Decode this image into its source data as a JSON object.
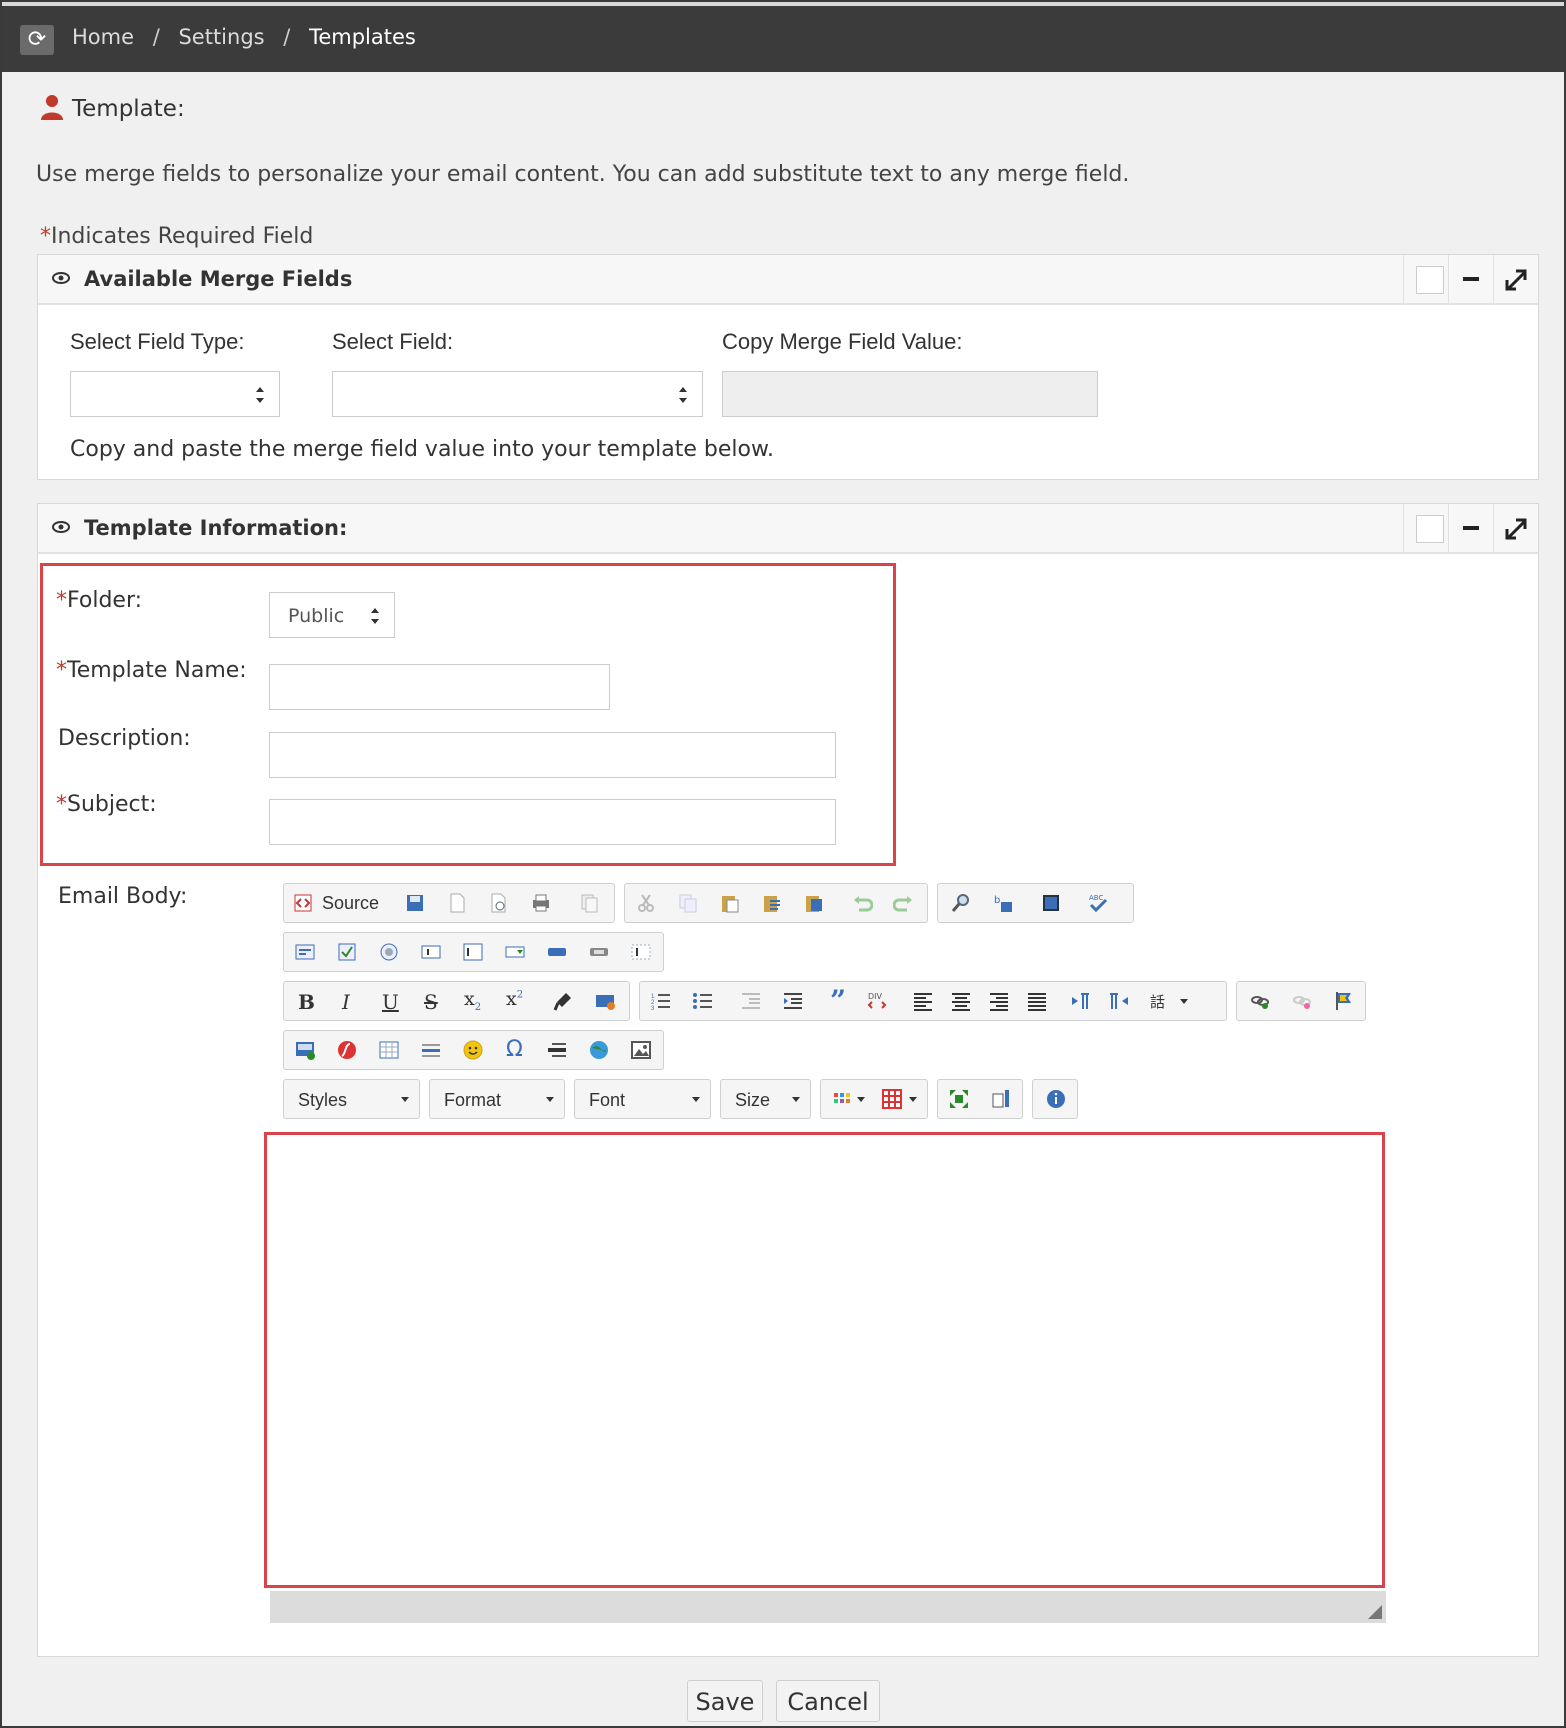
{
  "breadcrumb": {
    "home": "Home",
    "settings": "Settings",
    "current": "Templates",
    "separator": "/"
  },
  "page": {
    "title": "Template:",
    "intro": "Use merge fields to personalize your email content. You can add substitute text to any merge field.",
    "required_star": "*",
    "required_note": "Indicates Required Field"
  },
  "merge_panel": {
    "title": "Available Merge Fields",
    "field_type_label": "Select Field Type:",
    "field_label": "Select Field:",
    "copy_value_label": "Copy Merge Field Value:",
    "field_type_value": "",
    "field_value": "",
    "copy_value": "",
    "hint": "Copy and paste the merge field value into your template below."
  },
  "info_panel": {
    "title": "Template Information:",
    "folder_label": "Folder:",
    "folder_value": "Public",
    "name_label": "Template Name:",
    "description_label": "Description:",
    "subject_label": "Subject:",
    "body_label": "Email Body:"
  },
  "editor": {
    "source_label": "Source",
    "styles_label": "Styles",
    "format_label": "Format",
    "font_label": "Font",
    "size_label": "Size"
  },
  "actions": {
    "save": "Save",
    "cancel": "Cancel"
  },
  "colors": {
    "accent_red": "#d9434a",
    "topbar": "#3b3b3b",
    "background": "#f0f0f0"
  }
}
